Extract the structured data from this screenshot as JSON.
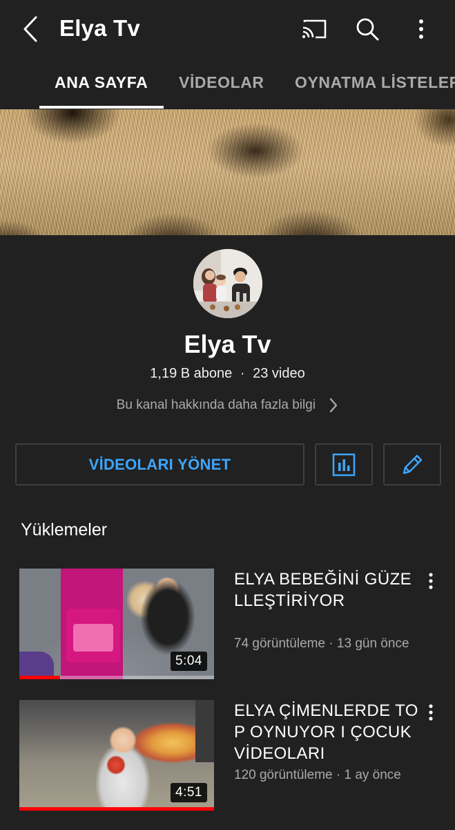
{
  "header": {
    "title": "Elya Tv",
    "back_icon": "chevron-left-icon",
    "cast_icon": "cast-icon",
    "search_icon": "search-icon",
    "more_icon": "more-vertical-icon"
  },
  "tabs": [
    {
      "label": "ANA SAYFA",
      "active": true
    },
    {
      "label": "VİDEOLAR",
      "active": false
    },
    {
      "label": "OYNATMA LİSTELERİ",
      "active": false
    }
  ],
  "channel": {
    "name": "Elya Tv",
    "subscribers": "1,19 B abone",
    "separator": "·",
    "video_count": "23 video",
    "about_link": "Bu kanal hakkında daha fazla bilgi"
  },
  "actions": {
    "manage_videos": "VİDEOLARI YÖNET",
    "stats_icon": "analytics-icon",
    "edit_icon": "pencil-icon"
  },
  "uploads": {
    "title": "Yüklemeler",
    "videos": [
      {
        "title": "ELYA BEBEĞİNİ GÜZELLEŞTİRİYOR",
        "views": "74 görüntüleme",
        "age": "13 gün önce",
        "meta": "74 görüntüleme · 13 gün önce",
        "duration": "5:04",
        "watched_fraction": 0.21
      },
      {
        "title": "ELYA ÇİMENLERDE TOP OYNUYOR I ÇOCUK VİDEOLARI",
        "views": "120 görüntüleme",
        "age": "1 ay önce",
        "meta": "120 görüntüleme · 1 ay önce",
        "duration": "4:51",
        "watched_fraction": 1.0
      }
    ]
  },
  "colors": {
    "background": "#212121",
    "accent_blue": "#3ea6ff",
    "progress_red": "#ff0000",
    "secondary_text": "#aaaaaa"
  }
}
